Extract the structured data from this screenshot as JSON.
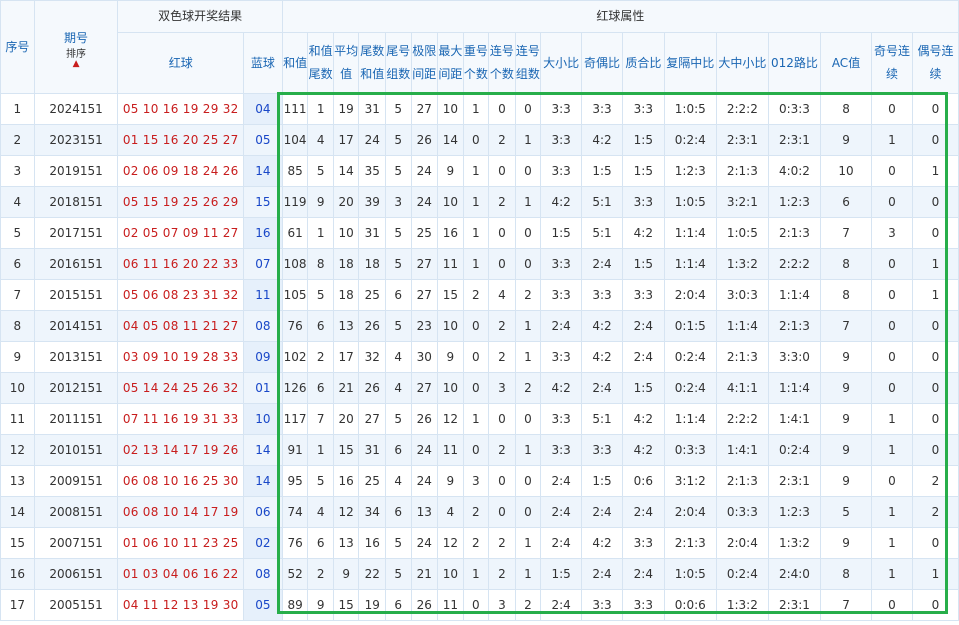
{
  "header": {
    "seq": "序号",
    "issue": "期号",
    "sort_label": "排序",
    "draw_group": "双色球开奖结果",
    "red_attr_group": "红球属性",
    "red_ball": "红球",
    "blue_ball": "蓝球",
    "sum": "和值",
    "sum_tail": "和值尾数",
    "avg": "平均值",
    "tail_sum": "尾数和值",
    "tail_groups": "尾号组数",
    "range": "极限间距",
    "max_gap": "最大间距",
    "repeat": "重号个数",
    "consec_count": "连号个数",
    "consec_groups": "连号组数",
    "big_small": "大小比",
    "odd_even": "奇偶比",
    "prime_comp": "质合比",
    "repeat_mid": "复隔中比",
    "big_mid_small": "大中小比",
    "road_012": "012路比",
    "ac": "AC值",
    "odd_consec": "奇号连续",
    "even_consec": "偶号连续"
  },
  "rows": [
    {
      "seq": "1",
      "issue": "2024151",
      "red": "05 10 16 19 29 32",
      "blue": "04",
      "sum": "111",
      "sumtail": "1",
      "avg": "19",
      "tailsum": "31",
      "tailgrp": "5",
      "range": "27",
      "maxgap": "10",
      "rep": "1",
      "ccount": "0",
      "cgroup": "0",
      "bs": "3:3",
      "oe": "3:3",
      "pc": "3:3",
      "rm": "1:0:5",
      "bms": "2:2:2",
      "r012": "0:3:3",
      "ac": "8",
      "oddc": "0",
      "evenc": "0"
    },
    {
      "seq": "2",
      "issue": "2023151",
      "red": "01 15 16 20 25 27",
      "blue": "05",
      "sum": "104",
      "sumtail": "4",
      "avg": "17",
      "tailsum": "24",
      "tailgrp": "5",
      "range": "26",
      "maxgap": "14",
      "rep": "0",
      "ccount": "2",
      "cgroup": "1",
      "bs": "3:3",
      "oe": "4:2",
      "pc": "1:5",
      "rm": "0:2:4",
      "bms": "2:3:1",
      "r012": "2:3:1",
      "ac": "9",
      "oddc": "1",
      "evenc": "0"
    },
    {
      "seq": "3",
      "issue": "2019151",
      "red": "02 06 09 18 24 26",
      "blue": "14",
      "sum": "85",
      "sumtail": "5",
      "avg": "14",
      "tailsum": "35",
      "tailgrp": "5",
      "range": "24",
      "maxgap": "9",
      "rep": "1",
      "ccount": "0",
      "cgroup": "0",
      "bs": "3:3",
      "oe": "1:5",
      "pc": "1:5",
      "rm": "1:2:3",
      "bms": "2:1:3",
      "r012": "4:0:2",
      "ac": "10",
      "oddc": "0",
      "evenc": "1"
    },
    {
      "seq": "4",
      "issue": "2018151",
      "red": "05 15 19 25 26 29",
      "blue": "15",
      "sum": "119",
      "sumtail": "9",
      "avg": "20",
      "tailsum": "39",
      "tailgrp": "3",
      "range": "24",
      "maxgap": "10",
      "rep": "1",
      "ccount": "2",
      "cgroup": "1",
      "bs": "4:2",
      "oe": "5:1",
      "pc": "3:3",
      "rm": "1:0:5",
      "bms": "3:2:1",
      "r012": "1:2:3",
      "ac": "6",
      "oddc": "0",
      "evenc": "0"
    },
    {
      "seq": "5",
      "issue": "2017151",
      "red": "02 05 07 09 11 27",
      "blue": "16",
      "sum": "61",
      "sumtail": "1",
      "avg": "10",
      "tailsum": "31",
      "tailgrp": "5",
      "range": "25",
      "maxgap": "16",
      "rep": "1",
      "ccount": "0",
      "cgroup": "0",
      "bs": "1:5",
      "oe": "5:1",
      "pc": "4:2",
      "rm": "1:1:4",
      "bms": "1:0:5",
      "r012": "2:1:3",
      "ac": "7",
      "oddc": "3",
      "evenc": "0"
    },
    {
      "seq": "6",
      "issue": "2016151",
      "red": "06 11 16 20 22 33",
      "blue": "07",
      "sum": "108",
      "sumtail": "8",
      "avg": "18",
      "tailsum": "18",
      "tailgrp": "5",
      "range": "27",
      "maxgap": "11",
      "rep": "1",
      "ccount": "0",
      "cgroup": "0",
      "bs": "3:3",
      "oe": "2:4",
      "pc": "1:5",
      "rm": "1:1:4",
      "bms": "1:3:2",
      "r012": "2:2:2",
      "ac": "8",
      "oddc": "0",
      "evenc": "1"
    },
    {
      "seq": "7",
      "issue": "2015151",
      "red": "05 06 08 23 31 32",
      "blue": "11",
      "sum": "105",
      "sumtail": "5",
      "avg": "18",
      "tailsum": "25",
      "tailgrp": "6",
      "range": "27",
      "maxgap": "15",
      "rep": "2",
      "ccount": "4",
      "cgroup": "2",
      "bs": "3:3",
      "oe": "3:3",
      "pc": "3:3",
      "rm": "2:0:4",
      "bms": "3:0:3",
      "r012": "1:1:4",
      "ac": "8",
      "oddc": "0",
      "evenc": "1"
    },
    {
      "seq": "8",
      "issue": "2014151",
      "red": "04 05 08 11 21 27",
      "blue": "08",
      "sum": "76",
      "sumtail": "6",
      "avg": "13",
      "tailsum": "26",
      "tailgrp": "5",
      "range": "23",
      "maxgap": "10",
      "rep": "0",
      "ccount": "2",
      "cgroup": "1",
      "bs": "2:4",
      "oe": "4:2",
      "pc": "2:4",
      "rm": "0:1:5",
      "bms": "1:1:4",
      "r012": "2:1:3",
      "ac": "7",
      "oddc": "0",
      "evenc": "0"
    },
    {
      "seq": "9",
      "issue": "2013151",
      "red": "03 09 10 19 28 33",
      "blue": "09",
      "sum": "102",
      "sumtail": "2",
      "avg": "17",
      "tailsum": "32",
      "tailgrp": "4",
      "range": "30",
      "maxgap": "9",
      "rep": "0",
      "ccount": "2",
      "cgroup": "1",
      "bs": "3:3",
      "oe": "4:2",
      "pc": "2:4",
      "rm": "0:2:4",
      "bms": "2:1:3",
      "r012": "3:3:0",
      "ac": "9",
      "oddc": "0",
      "evenc": "0"
    },
    {
      "seq": "10",
      "issue": "2012151",
      "red": "05 14 24 25 26 32",
      "blue": "01",
      "sum": "126",
      "sumtail": "6",
      "avg": "21",
      "tailsum": "26",
      "tailgrp": "4",
      "range": "27",
      "maxgap": "10",
      "rep": "0",
      "ccount": "3",
      "cgroup": "2",
      "bs": "4:2",
      "oe": "2:4",
      "pc": "1:5",
      "rm": "0:2:4",
      "bms": "4:1:1",
      "r012": "1:1:4",
      "ac": "9",
      "oddc": "0",
      "evenc": "0"
    },
    {
      "seq": "11",
      "issue": "2011151",
      "red": "07 11 16 19 31 33",
      "blue": "10",
      "sum": "117",
      "sumtail": "7",
      "avg": "20",
      "tailsum": "27",
      "tailgrp": "5",
      "range": "26",
      "maxgap": "12",
      "rep": "1",
      "ccount": "0",
      "cgroup": "0",
      "bs": "3:3",
      "oe": "5:1",
      "pc": "4:2",
      "rm": "1:1:4",
      "bms": "2:2:2",
      "r012": "1:4:1",
      "ac": "9",
      "oddc": "1",
      "evenc": "0"
    },
    {
      "seq": "12",
      "issue": "2010151",
      "red": "02 13 14 17 19 26",
      "blue": "14",
      "sum": "91",
      "sumtail": "1",
      "avg": "15",
      "tailsum": "31",
      "tailgrp": "6",
      "range": "24",
      "maxgap": "11",
      "rep": "0",
      "ccount": "2",
      "cgroup": "1",
      "bs": "3:3",
      "oe": "3:3",
      "pc": "4:2",
      "rm": "0:3:3",
      "bms": "1:4:1",
      "r012": "0:2:4",
      "ac": "9",
      "oddc": "1",
      "evenc": "0"
    },
    {
      "seq": "13",
      "issue": "2009151",
      "red": "06 08 10 16 25 30",
      "blue": "14",
      "sum": "95",
      "sumtail": "5",
      "avg": "16",
      "tailsum": "25",
      "tailgrp": "4",
      "range": "24",
      "maxgap": "9",
      "rep": "3",
      "ccount": "0",
      "cgroup": "0",
      "bs": "2:4",
      "oe": "1:5",
      "pc": "0:6",
      "rm": "3:1:2",
      "bms": "2:1:3",
      "r012": "2:3:1",
      "ac": "9",
      "oddc": "0",
      "evenc": "2"
    },
    {
      "seq": "14",
      "issue": "2008151",
      "red": "06 08 10 14 17 19",
      "blue": "06",
      "sum": "74",
      "sumtail": "4",
      "avg": "12",
      "tailsum": "34",
      "tailgrp": "6",
      "range": "13",
      "maxgap": "4",
      "rep": "2",
      "ccount": "0",
      "cgroup": "0",
      "bs": "2:4",
      "oe": "2:4",
      "pc": "2:4",
      "rm": "2:0:4",
      "bms": "0:3:3",
      "r012": "1:2:3",
      "ac": "5",
      "oddc": "1",
      "evenc": "2"
    },
    {
      "seq": "15",
      "issue": "2007151",
      "red": "01 06 10 11 23 25",
      "blue": "02",
      "sum": "76",
      "sumtail": "6",
      "avg": "13",
      "tailsum": "16",
      "tailgrp": "5",
      "range": "24",
      "maxgap": "12",
      "rep": "2",
      "ccount": "2",
      "cgroup": "1",
      "bs": "2:4",
      "oe": "4:2",
      "pc": "3:3",
      "rm": "2:1:3",
      "bms": "2:0:4",
      "r012": "1:3:2",
      "ac": "9",
      "oddc": "1",
      "evenc": "0"
    },
    {
      "seq": "16",
      "issue": "2006151",
      "red": "01 03 04 06 16 22",
      "blue": "08",
      "sum": "52",
      "sumtail": "2",
      "avg": "9",
      "tailsum": "22",
      "tailgrp": "5",
      "range": "21",
      "maxgap": "10",
      "rep": "1",
      "ccount": "2",
      "cgroup": "1",
      "bs": "1:5",
      "oe": "2:4",
      "pc": "2:4",
      "rm": "1:0:5",
      "bms": "0:2:4",
      "r012": "2:4:0",
      "ac": "8",
      "oddc": "1",
      "evenc": "1"
    },
    {
      "seq": "17",
      "issue": "2005151",
      "red": "04 11 12 13 19 30",
      "blue": "05",
      "sum": "89",
      "sumtail": "9",
      "avg": "15",
      "tailsum": "19",
      "tailgrp": "6",
      "range": "26",
      "maxgap": "11",
      "rep": "0",
      "ccount": "3",
      "cgroup": "2",
      "bs": "2:4",
      "oe": "3:3",
      "pc": "3:3",
      "rm": "0:0:6",
      "bms": "1:3:2",
      "r012": "2:3:1",
      "ac": "7",
      "oddc": "0",
      "evenc": "0"
    }
  ]
}
